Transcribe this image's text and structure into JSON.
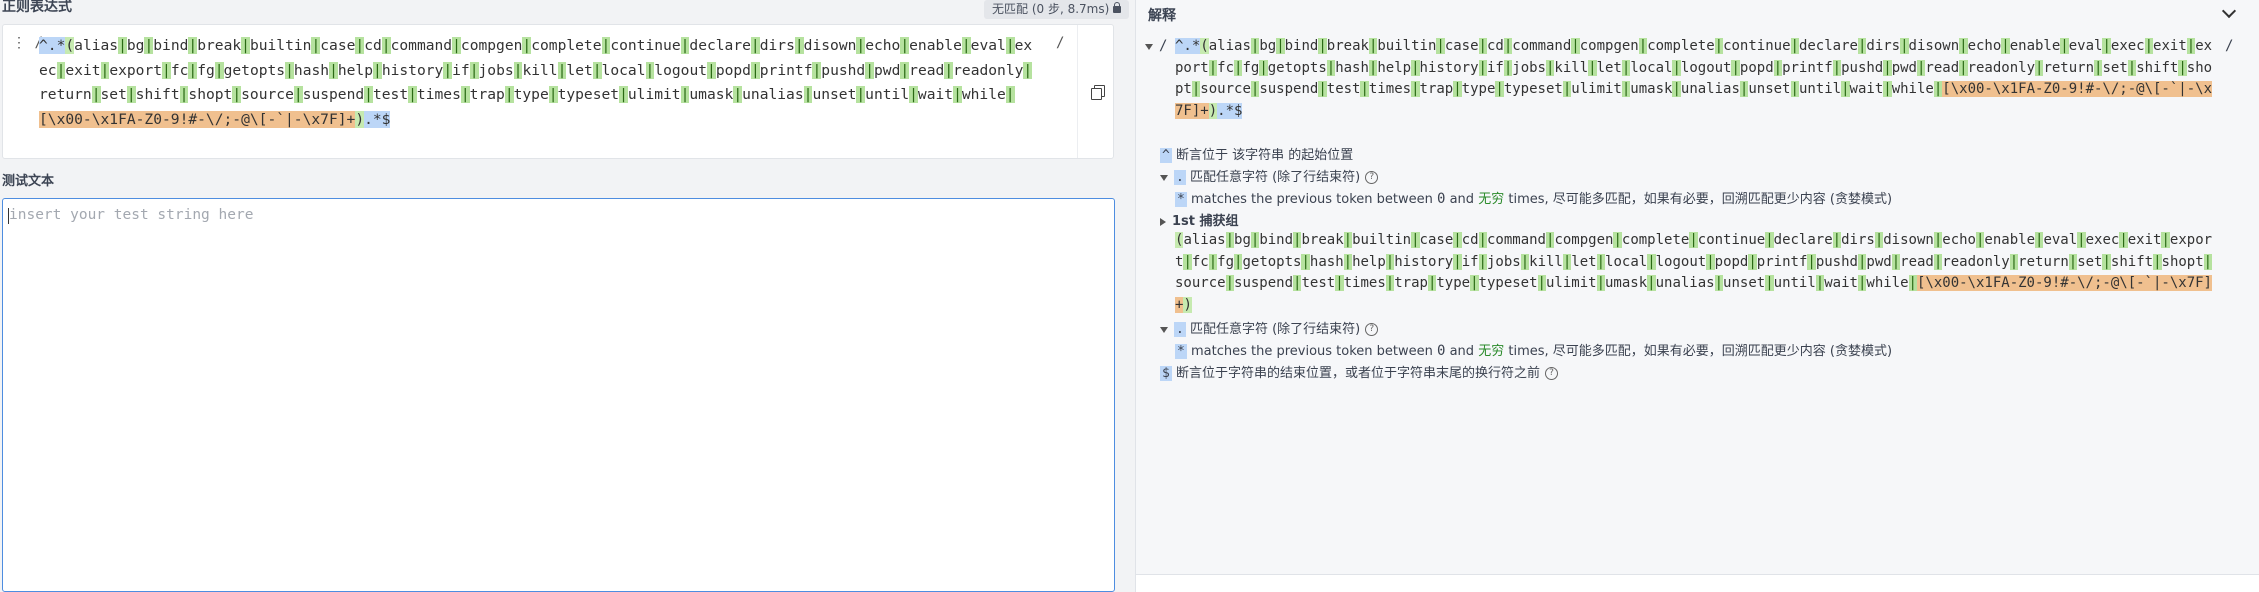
{
  "left": {
    "regex_title": "正则表达式",
    "match_badge": "无匹配 (0 步, 8.7ms)",
    "delim_left": "/",
    "delim_right": "/",
    "regex_prefix": "^.*",
    "regex_group_open": "(",
    "regex_alts": [
      "alias",
      "bg",
      "bind",
      "break",
      "builtin",
      "case",
      "cd",
      "command",
      "compgen",
      "complete",
      "continue",
      "declare",
      "dirs",
      "disown",
      "echo",
      "enable",
      "eval",
      "exec",
      "exit",
      "export",
      "fc",
      "fg",
      "getopts",
      "hash",
      "help",
      "history",
      "if",
      "jobs",
      "kill",
      "let",
      "local",
      "logout",
      "popd",
      "printf",
      "pushd",
      "pwd",
      "read",
      "readonly",
      "return",
      "set",
      "shift",
      "shopt",
      "source",
      "suspend",
      "test",
      "times",
      "trap",
      "type",
      "typeset",
      "ulimit",
      "umask",
      "unalias",
      "unset",
      "until",
      "wait",
      "while"
    ],
    "regex_class": "[\\x00-\\x1FA-Z0-9!#-\\/;-@\\[-`|-\\x7F]+",
    "regex_group_close": ")",
    "regex_suffix": ".*$",
    "test_title": "测试文本",
    "test_placeholder": "insert your test string here"
  },
  "right": {
    "title": "解释",
    "top_delim": "/",
    "caret_desc": "断言位于 该字符串 的起始位置",
    "dot_desc": "匹配任意字符 (除了行结束符)",
    "star_desc_pre": "matches the previous token between",
    "star_zero": "0",
    "star_and": "and",
    "star_inf": "无穷",
    "star_desc_post": "times, 尽可能多匹配，如果有必要，回溯匹配更少内容 (贪婪模式)",
    "group_label": "1st 捕获组",
    "dot2_desc": "匹配任意字符 (除了行结束符)",
    "dollar_desc": "断言位于字符串的结束位置，或者位于字符串末尾的换行符之前"
  }
}
